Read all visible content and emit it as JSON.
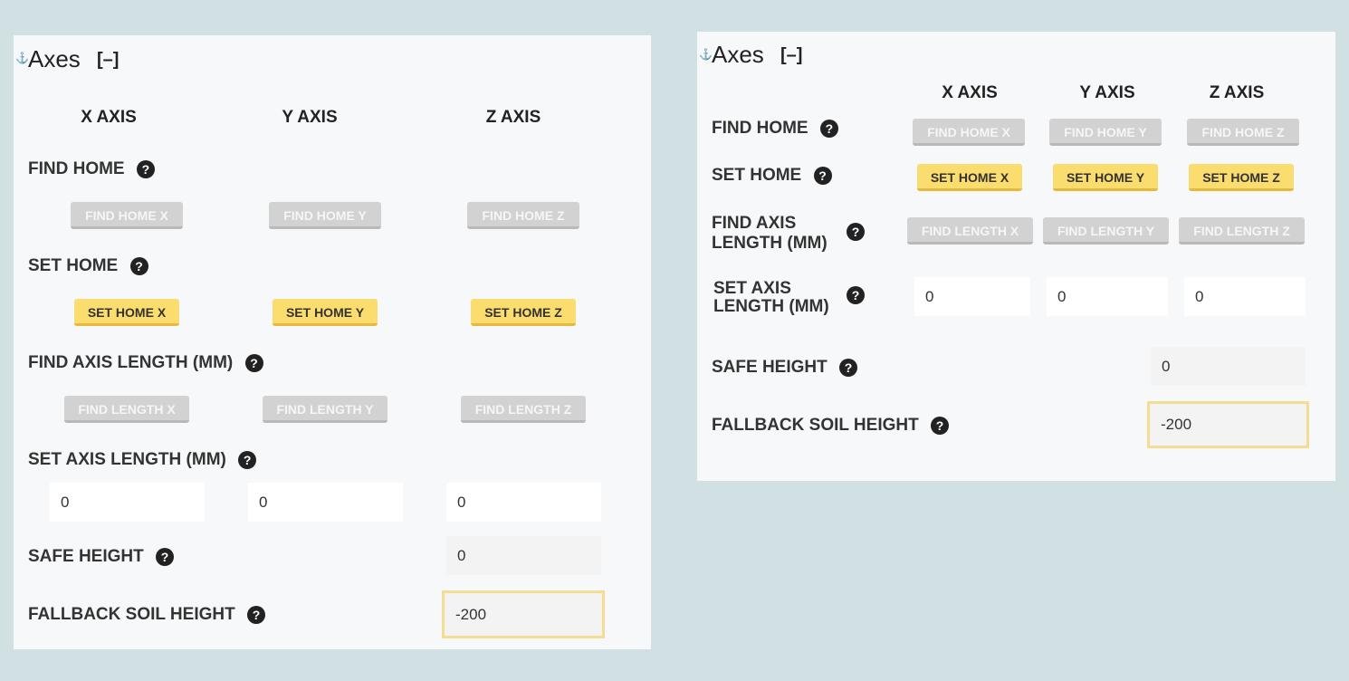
{
  "section": {
    "title": "Axes",
    "collapse": "[–]",
    "anchor": "⚓"
  },
  "axes": {
    "x": "X AXIS",
    "y": "Y AXIS",
    "z": "Z AXIS"
  },
  "labels": {
    "find_home": "FIND HOME",
    "set_home": "SET HOME",
    "find_axis_length": "FIND AXIS LENGTH (MM)",
    "find_axis_length_l1": "FIND AXIS",
    "find_axis_length_l2": "LENGTH (MM)",
    "set_axis_length": "SET AXIS LENGTH (MM)",
    "set_axis_length_l1": "SET AXIS",
    "set_axis_length_l2": "LENGTH (MM)",
    "safe_height": "SAFE HEIGHT",
    "fallback_soil_height": "FALLBACK SOIL HEIGHT"
  },
  "help_glyph": "?",
  "buttons": {
    "find_home": [
      "FIND HOME X",
      "FIND HOME Y",
      "FIND HOME Z"
    ],
    "set_home": [
      "SET HOME X",
      "SET HOME Y",
      "SET HOME Z"
    ],
    "find_length": [
      "FIND LENGTH X",
      "FIND LENGTH Y",
      "FIND LENGTH Z"
    ]
  },
  "values": {
    "axis_length": [
      "0",
      "0",
      "0"
    ],
    "safe_height": "0",
    "fallback_soil_height": "-200"
  },
  "colors": {
    "accent_yellow": "#fbdc6f",
    "disabled_gray": "#d2d2d2",
    "highlight_border": "#f4dc93"
  }
}
